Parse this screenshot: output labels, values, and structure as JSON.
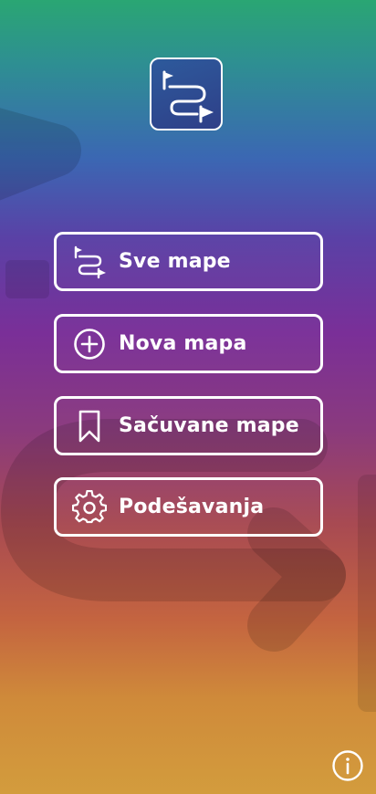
{
  "app": {
    "logo_icon": "route-flags-icon"
  },
  "menu": {
    "items": [
      {
        "label": "Sve mape",
        "icon": "route-list-icon"
      },
      {
        "label": "Nova mapa",
        "icon": "plus-circle-icon"
      },
      {
        "label": "Sačuvane mape",
        "icon": "bookmark-icon"
      },
      {
        "label": "Podešavanja",
        "icon": "gear-icon"
      }
    ]
  },
  "footer": {
    "info_icon": "info-icon"
  },
  "colors": {
    "gradient_top": "#2aa673",
    "gradient_mid": "#7a2f98",
    "gradient_bottom": "#d39c3d",
    "button_border": "#ffffff",
    "text": "#ffffff"
  }
}
